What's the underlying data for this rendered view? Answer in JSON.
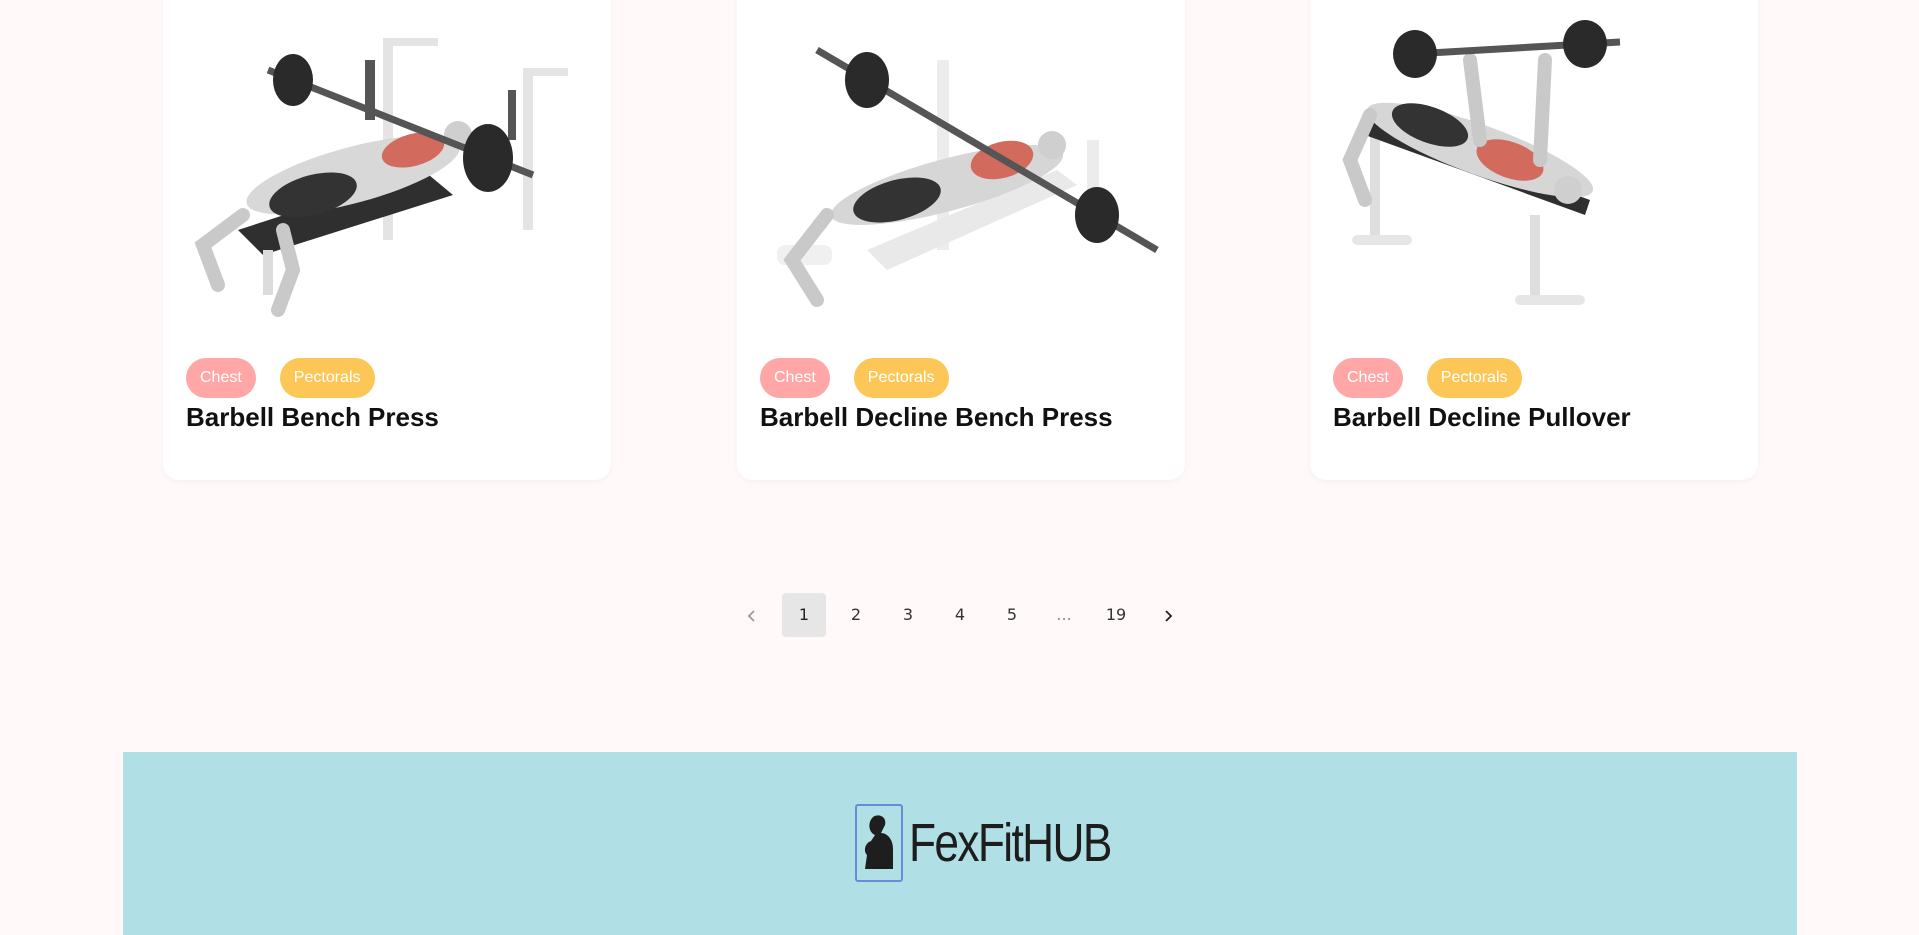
{
  "cards": [
    {
      "tags": [
        "Chest",
        "Pectorals"
      ],
      "title": "Barbell Bench Press",
      "image_icon": "barbell-bench-press-illustration"
    },
    {
      "tags": [
        "Chest",
        "Pectorals"
      ],
      "title": "Barbell Decline Bench Press",
      "image_icon": "barbell-decline-bench-press-illustration"
    },
    {
      "tags": [
        "Chest",
        "Pectorals"
      ],
      "title": "Barbell Decline Pullover",
      "image_icon": "barbell-decline-pullover-illustration"
    }
  ],
  "pagination": {
    "prev_icon": "chevron-left-icon",
    "pages": [
      "1",
      "2",
      "3",
      "4",
      "5",
      "...",
      "19"
    ],
    "current": "1",
    "next_icon": "chevron-right-icon"
  },
  "footer": {
    "logo_text": "FexFitHUB",
    "logo_icon": "flexed-arm-icon",
    "background": "#b0dfe5"
  },
  "colors": {
    "page_bg": "#fff9f9",
    "tag_chest": "#ffa7a7",
    "tag_pectorals": "#fcc757"
  }
}
